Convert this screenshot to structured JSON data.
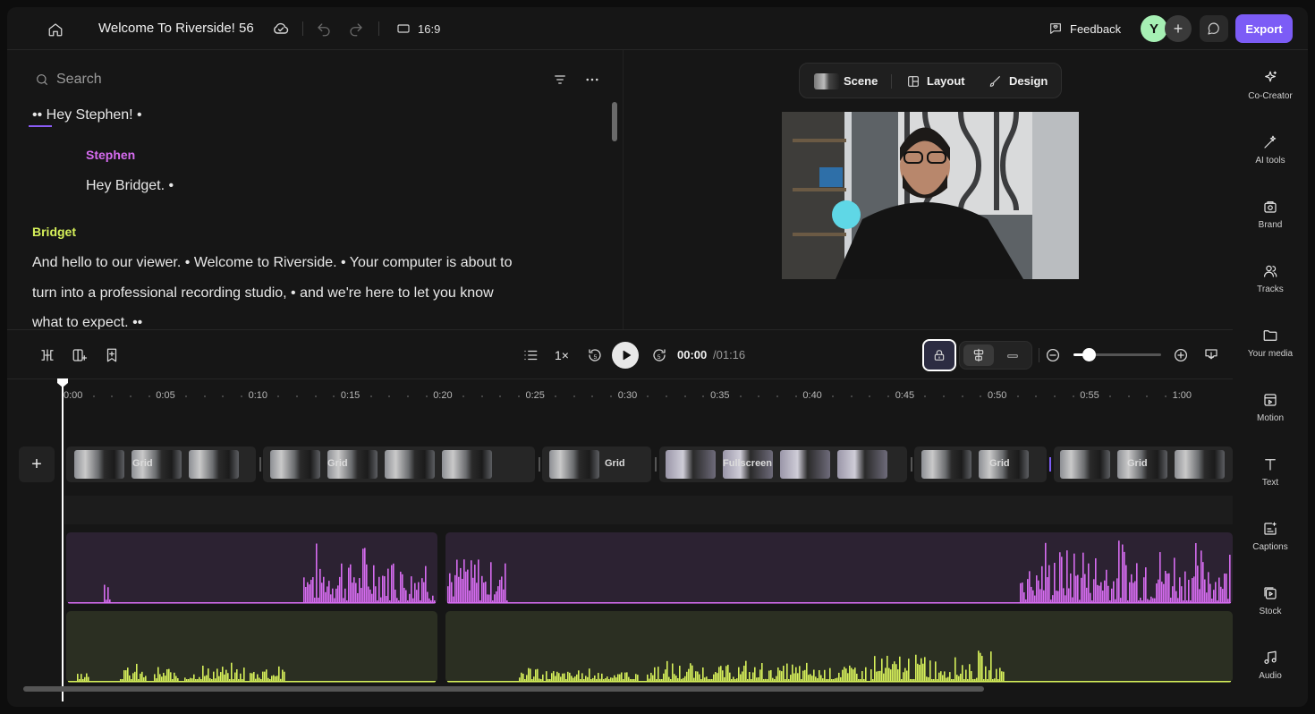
{
  "header": {
    "project_title": "Welcome To Riverside! 56",
    "aspect_ratio": "16:9",
    "feedback_label": "Feedback",
    "avatar_initial": "Y",
    "export_label": "Export"
  },
  "transcript": {
    "search_placeholder": "Search",
    "lines": [
      "•• Hey Stephen! •",
      "Stephen",
      "Hey Bridget. •",
      "Bridget",
      "And hello to our viewer. • Welcome to Riverside. • Your computer is about to",
      "turn into a professional recording studio, • and we're here to let you know",
      "what to expect. ••"
    ]
  },
  "preview": {
    "scene_label": "Scene",
    "layout_label": "Layout",
    "design_label": "Design"
  },
  "sidebar": {
    "items": [
      {
        "label": "Co-Creator",
        "icon": "sparkle-icon"
      },
      {
        "label": "AI tools",
        "icon": "magic-wand-icon"
      },
      {
        "label": "Brand",
        "icon": "brand-icon"
      },
      {
        "label": "Tracks",
        "icon": "users-icon"
      },
      {
        "label": "Your media",
        "icon": "folder-icon"
      },
      {
        "label": "Motion",
        "icon": "motion-icon"
      },
      {
        "label": "Text",
        "icon": "text-icon"
      },
      {
        "label": "Captions",
        "icon": "captions-icon"
      },
      {
        "label": "Stock",
        "icon": "stock-icon"
      },
      {
        "label": "Audio",
        "icon": "music-icon"
      }
    ]
  },
  "timeline": {
    "speed": "1×",
    "current_time": "00:00",
    "total_time": "/01:16",
    "ruler": [
      "0:00",
      "0:05",
      "0:10",
      "0:15",
      "0:20",
      "0:25",
      "0:30",
      "0:35",
      "0:40",
      "0:45",
      "0:50",
      "0:55",
      "1:00"
    ],
    "clip_labels": [
      "Grid",
      "Grid",
      "Grid",
      "Fullscreen",
      "Grid",
      "Grid"
    ],
    "colors": {
      "speaker_1": "#d66cf0",
      "speaker_2": "#d6f05a",
      "accent": "#7c5cf6"
    }
  }
}
